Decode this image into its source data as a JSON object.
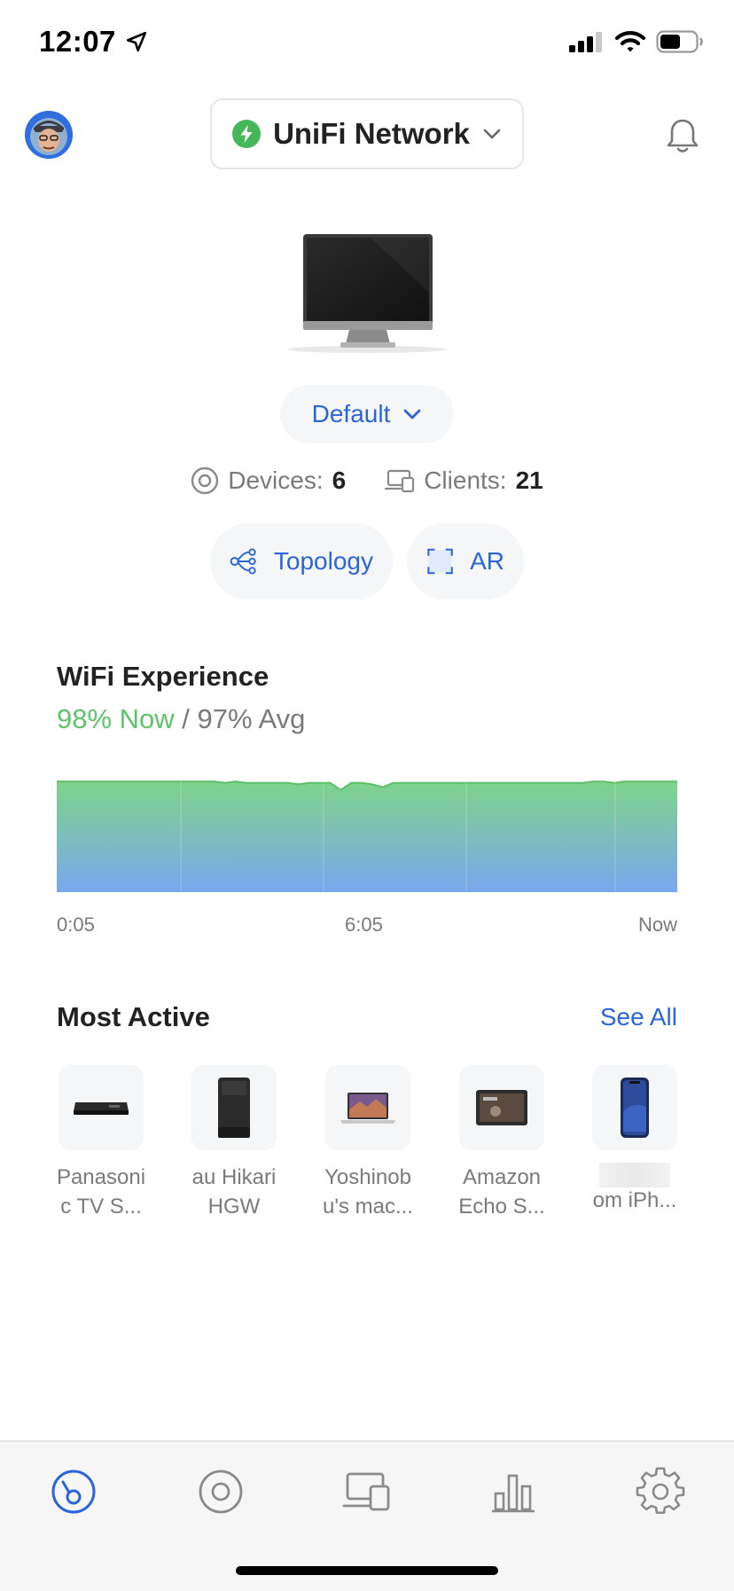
{
  "status_bar": {
    "time": "12:07"
  },
  "header": {
    "network_title": "UniFi Network"
  },
  "gateway": {
    "site_label": "Default"
  },
  "stats": {
    "devices_label": "Devices:",
    "devices_count": "6",
    "clients_label": "Clients:",
    "clients_count": "21"
  },
  "actions": {
    "topology_label": "Topology",
    "ar_label": "AR"
  },
  "wifi_experience": {
    "title": "WiFi Experience",
    "now": "98% Now",
    "separator": " / ",
    "avg": "97% Avg",
    "chart_data": {
      "type": "area",
      "x_tick_labels": [
        "0:05",
        "6:05",
        "Now"
      ],
      "values": [
        98,
        98,
        98,
        98,
        98,
        98,
        98,
        98,
        98,
        98,
        98,
        98,
        98,
        98,
        98,
        98,
        97,
        98,
        97,
        97,
        97,
        97,
        97,
        96,
        97,
        97,
        97,
        92,
        97,
        97,
        96,
        94,
        97,
        97,
        97,
        97,
        97,
        97,
        97,
        97,
        97,
        97,
        97,
        97,
        97,
        97,
        97,
        97,
        97,
        97,
        97,
        98,
        98,
        97,
        98,
        98,
        98,
        98,
        98,
        98
      ]
    }
  },
  "most_active": {
    "title": "Most Active",
    "see_all": "See All",
    "items": [
      {
        "line1": "Panasoni",
        "line2": "c TV S...",
        "icon": "tv-receiver-icon"
      },
      {
        "line1": "au Hikari",
        "line2": "HGW",
        "icon": "router-icon"
      },
      {
        "line1": "Yoshinob",
        "line2": "u's mac...",
        "icon": "laptop-icon"
      },
      {
        "line1": "Amazon",
        "line2": "Echo S...",
        "icon": "smart-display-icon"
      },
      {
        "line1": "",
        "line2": "om iPh...",
        "icon": "phone-icon"
      }
    ]
  },
  "colors": {
    "accent": "#2a66d9",
    "good": "#5cc469",
    "chart_top": "#7ed38a",
    "chart_bottom": "#7aa7ee"
  }
}
